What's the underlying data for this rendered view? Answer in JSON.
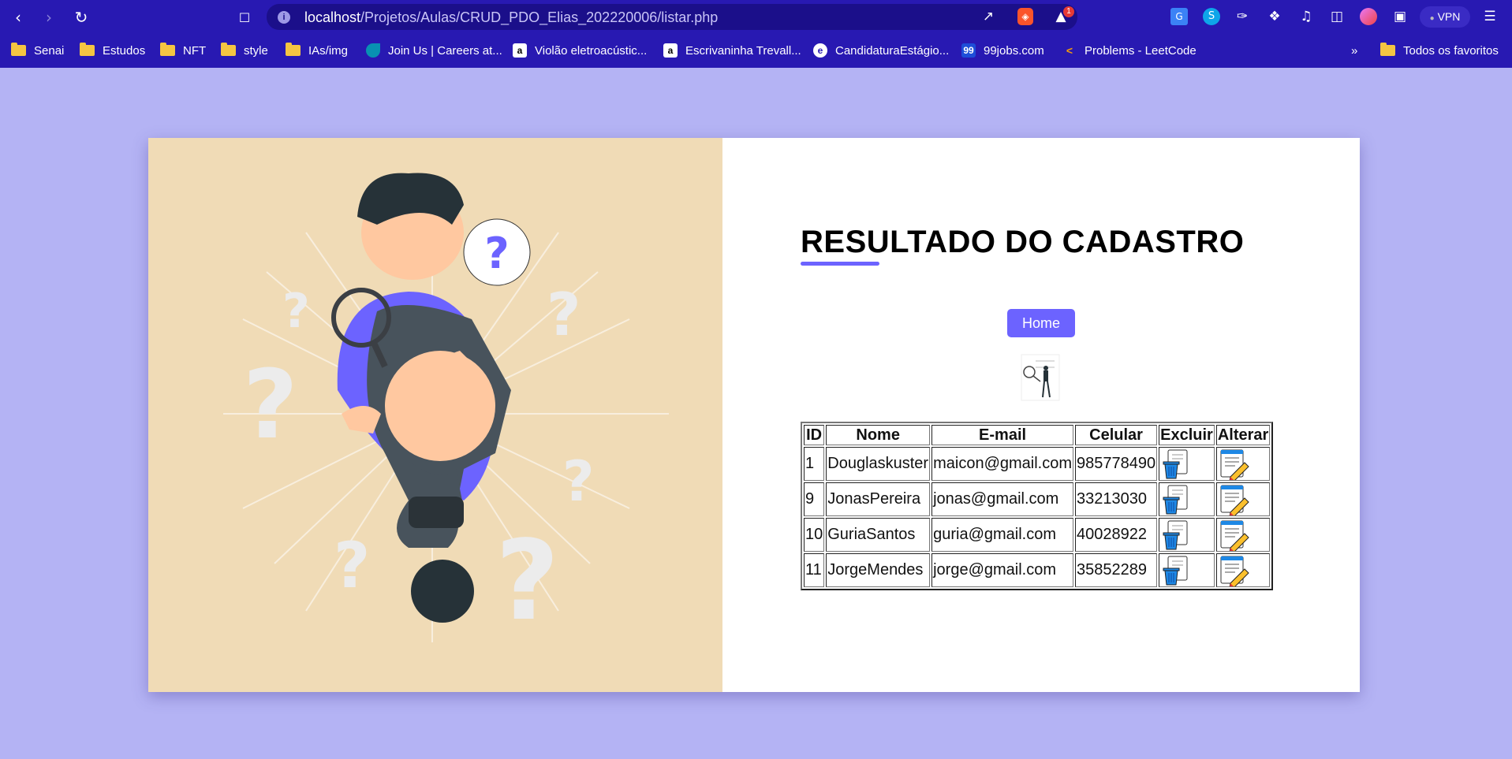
{
  "browser": {
    "url_host": "localhost",
    "url_path": "/Projetos/Aulas/CRUD_PDO_Elias_202220006/listar.php",
    "vpn_label": "VPN",
    "notification_count": "1",
    "bookmarks": [
      {
        "label": "Senai",
        "icon": "folder-icon"
      },
      {
        "label": "Estudos",
        "icon": "folder-icon"
      },
      {
        "label": "NFT",
        "icon": "folder-icon"
      },
      {
        "label": "style",
        "icon": "folder-icon"
      },
      {
        "label": "IAs/img",
        "icon": "folder-icon"
      },
      {
        "label": "Join Us | Careers at...",
        "icon": "site-icon"
      },
      {
        "label": "Violão eletroacústic...",
        "icon": "amazon-icon"
      },
      {
        "label": "Escrivaninha Trevall...",
        "icon": "amazon-icon"
      },
      {
        "label": "CandidaturaEstágio...",
        "icon": "site-icon"
      },
      {
        "label": "99jobs.com",
        "icon": "site-icon"
      },
      {
        "label": "Problems - LeetCode",
        "icon": "leetcode-icon"
      }
    ],
    "more_bookmarks": "»",
    "all_favorites": "Todos os favoritos"
  },
  "page": {
    "title": "RESULTADO DO CADASTRO",
    "home_button": "Home",
    "accent_color": "#6c63ff",
    "table": {
      "headers": [
        "ID",
        "Nome",
        "E-mail",
        "Celular",
        "Excluir",
        "Alterar"
      ],
      "rows": [
        {
          "id": "1",
          "nome": "Douglaskuster",
          "email": "maicon@gmail.com",
          "celular": "985778490"
        },
        {
          "id": "9",
          "nome": "JonasPereira",
          "email": "jonas@gmail.com",
          "celular": "33213030"
        },
        {
          "id": "10",
          "nome": "GuriaSantos",
          "email": "guria@gmail.com",
          "celular": "40028922"
        },
        {
          "id": "11",
          "nome": "JorgeMendes",
          "email": "jorge@gmail.com",
          "celular": "35852289"
        }
      ]
    }
  }
}
